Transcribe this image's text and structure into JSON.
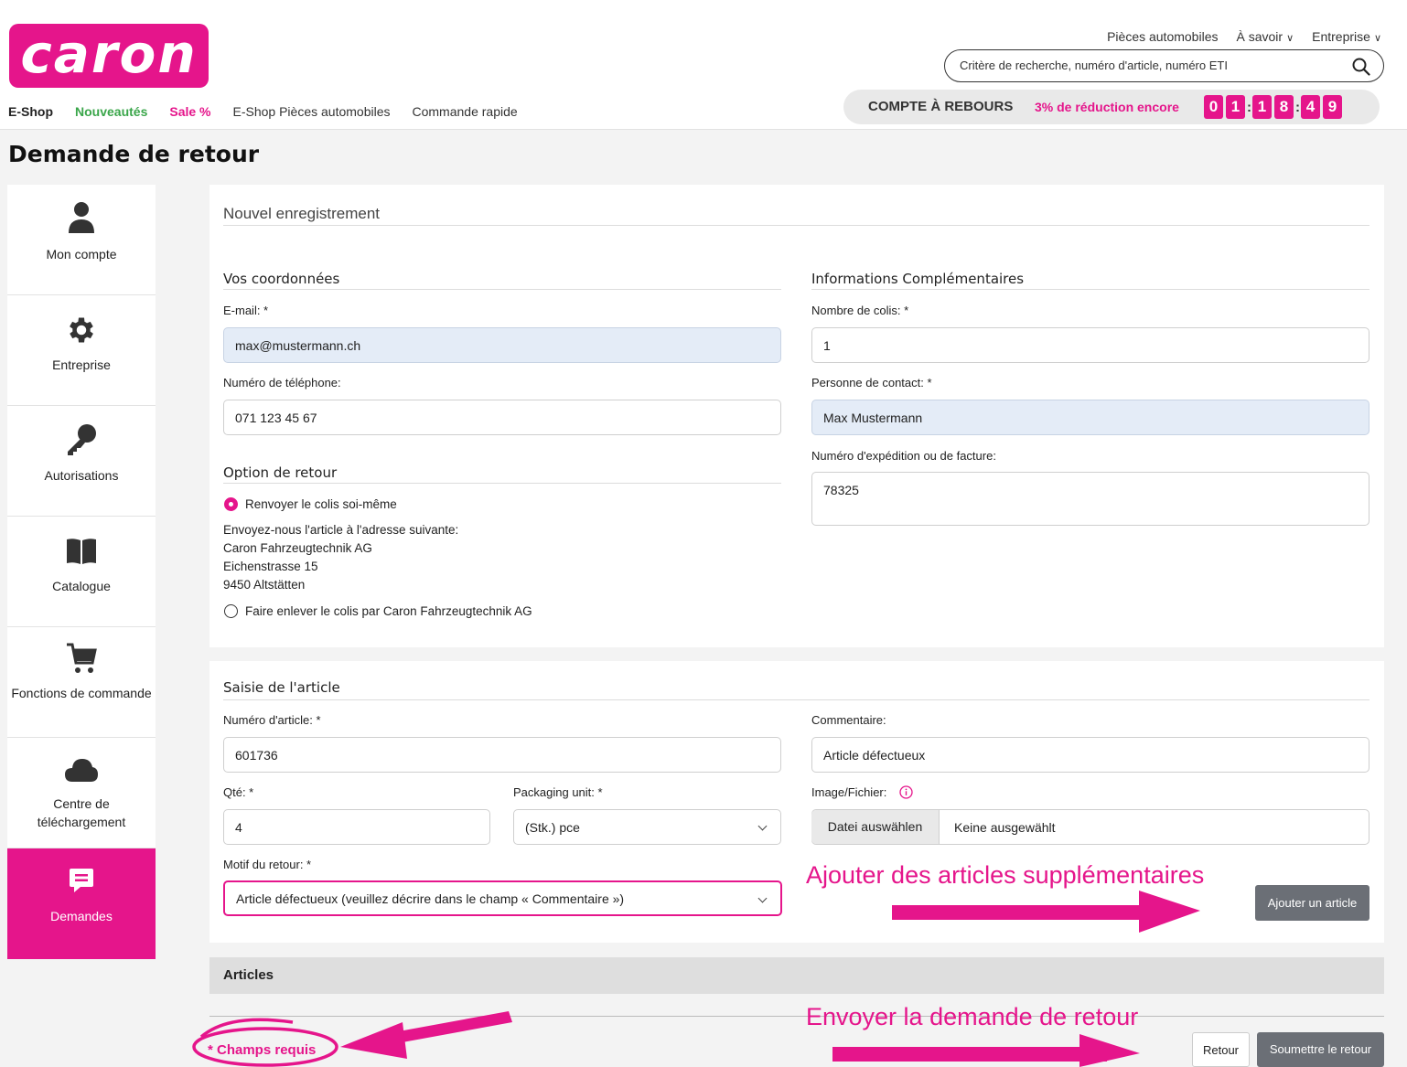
{
  "brand": {
    "logo_text": "caron",
    "accent": "#e5158b",
    "green": "#3aa64a"
  },
  "nav": {
    "main": [
      "E-Shop",
      "Nouveautés",
      "Sale %",
      "E-Shop Pièces automobiles",
      "Commande rapide"
    ],
    "top": [
      "Pièces automobiles",
      "À savoir",
      "Entreprise"
    ],
    "search_placeholder": "Critère de recherche, numéro d'article, numéro ETI"
  },
  "countdown": {
    "label": "COMPTE À REBOURS",
    "promo": "3% de réduction encore",
    "digits": [
      "0",
      "1",
      "1",
      "8",
      "4",
      "9"
    ]
  },
  "page": {
    "title": "Demande de retour"
  },
  "sidebar": [
    {
      "label": "Mon compte",
      "icon": "user-icon"
    },
    {
      "label": "Entreprise",
      "icon": "gear-icon"
    },
    {
      "label": "Autorisations",
      "icon": "key-icon"
    },
    {
      "label": "Catalogue",
      "icon": "book-icon"
    },
    {
      "label": "Fonctions de commande",
      "icon": "cart-icon"
    },
    {
      "label": "Centre de téléchargement",
      "icon": "cloud-icon"
    },
    {
      "label": "Demandes",
      "icon": "message-icon",
      "active": true
    }
  ],
  "form": {
    "heading": "Nouvel enregistrement",
    "contact": {
      "title": "Vos coordonnées",
      "email_label": "E-mail: *",
      "email": "max@mustermann.ch",
      "phone_label": "Numéro de téléphone:",
      "phone": "071 123 45 67"
    },
    "extra": {
      "title": "Informations Complémentaires",
      "parcels_label": "Nombre de colis: *",
      "parcels": "1",
      "contact_label": "Personne de contact: *",
      "contact": "Max Mustermann",
      "invoice_label": "Numéro d'expédition ou de facture:",
      "invoice": "78325"
    },
    "return_option": {
      "title": "Option de retour",
      "opt1": "Renvoyer le colis soi-même",
      "address_intro": "Envoyez-nous l'article à l'adresse suivante:",
      "address1": "Caron Fahrzeugtechnik AG",
      "address2": "Eichenstrasse 15",
      "address3": "9450 Altstätten",
      "opt2": "Faire enlever le colis par Caron Fahrzeugtechnik AG"
    },
    "article": {
      "title": "Saisie de l'article",
      "number_label": "Numéro d'article: *",
      "number": "601736",
      "qty_label": "Qté: *",
      "qty": "4",
      "unit_label": "Packaging unit: *",
      "unit": "(Stk.) pce",
      "reason_label": "Motif du retour: *",
      "reason": "Article défectueux (veuillez décrire dans le champ « Commentaire »)",
      "comment_label": "Commentaire:",
      "comment": "Article défectueux",
      "file_label": "Image/Fichier:",
      "file_button": "Datei auswählen",
      "file_status": "Keine ausgewählt",
      "add_button": "Ajouter un article"
    },
    "articles_title": "Articles",
    "required_note": "* Champs requis",
    "back_button": "Retour",
    "submit_button": "Soumettre le retour"
  },
  "annotations": {
    "add_more": "Ajouter des articles supplémentaires",
    "send": "Envoyer la demande de retour"
  }
}
